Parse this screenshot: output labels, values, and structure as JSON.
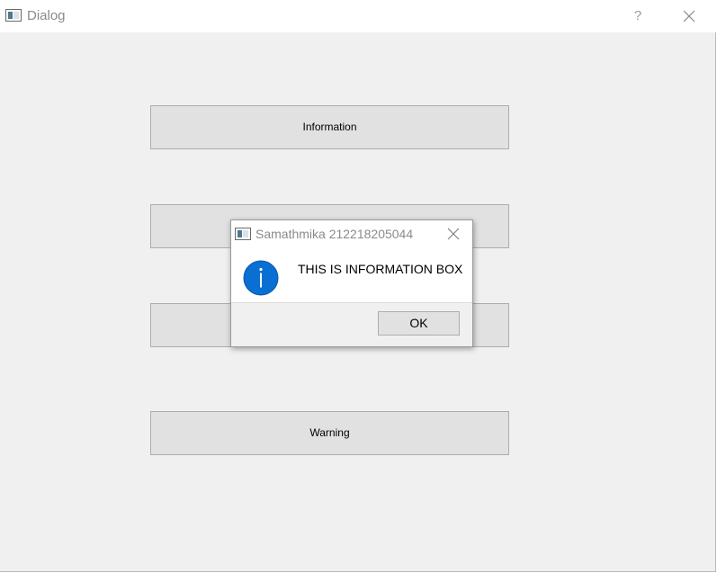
{
  "window": {
    "title": "Dialog",
    "help_label": "?"
  },
  "buttons": [
    {
      "label": "Information"
    },
    {
      "label": ""
    },
    {
      "label": ""
    },
    {
      "label": "Warning"
    }
  ],
  "message_box": {
    "title": "Samathmika 212218205044",
    "text": "THIS IS INFORMATION BOX",
    "ok_label": "OK",
    "icon": "information-icon"
  },
  "colors": {
    "info_icon_blue": "#0a6fd3"
  }
}
